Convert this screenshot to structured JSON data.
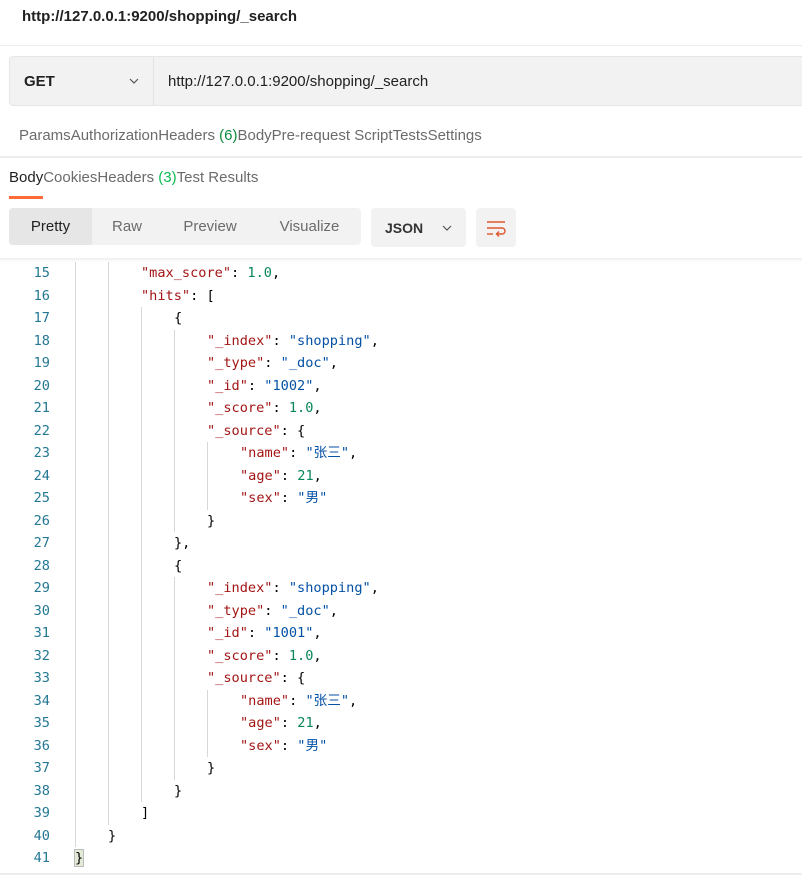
{
  "window": {
    "title": "http://127.0.0.1:9200/shopping/_search"
  },
  "request": {
    "method": "GET",
    "url": "http://127.0.0.1:9200/shopping/_search"
  },
  "request_tabs": [
    {
      "label": "Params"
    },
    {
      "label": "Authorization"
    },
    {
      "label": "Headers",
      "count": "(6)"
    },
    {
      "label": "Body"
    },
    {
      "label": "Pre-request Script"
    },
    {
      "label": "Tests"
    },
    {
      "label": "Settings"
    }
  ],
  "response_tabs": [
    {
      "label": "Body",
      "active": true
    },
    {
      "label": "Cookies"
    },
    {
      "label": "Headers",
      "count": "(3)"
    },
    {
      "label": "Test Results"
    }
  ],
  "view_modes": [
    {
      "label": "Pretty",
      "active": true
    },
    {
      "label": "Raw"
    },
    {
      "label": "Preview"
    },
    {
      "label": "Visualize"
    }
  ],
  "format": {
    "selected": "JSON"
  },
  "colors": {
    "accent": "#ff6c37",
    "key": "#a31515",
    "string": "#0451a5",
    "number": "#098658",
    "line_number": "#237893"
  },
  "icons": {
    "method_dropdown": "chevron-down-icon",
    "format_dropdown": "chevron-down-icon",
    "wrap": "wrap-lines-icon"
  },
  "code_lines": [
    {
      "n": "15",
      "indent": 2,
      "tokens": [
        [
          "k",
          "\"max_score\""
        ],
        [
          "p",
          ": "
        ],
        [
          "n",
          "1.0"
        ],
        [
          "p",
          ","
        ]
      ]
    },
    {
      "n": "16",
      "indent": 2,
      "tokens": [
        [
          "k",
          "\"hits\""
        ],
        [
          "p",
          ": ["
        ]
      ]
    },
    {
      "n": "17",
      "indent": 3,
      "tokens": [
        [
          "p",
          "{"
        ]
      ]
    },
    {
      "n": "18",
      "indent": 4,
      "tokens": [
        [
          "k",
          "\"_index\""
        ],
        [
          "p",
          ": "
        ],
        [
          "s",
          "\"shopping\""
        ],
        [
          "p",
          ","
        ]
      ]
    },
    {
      "n": "19",
      "indent": 4,
      "tokens": [
        [
          "k",
          "\"_type\""
        ],
        [
          "p",
          ": "
        ],
        [
          "s",
          "\"_doc\""
        ],
        [
          "p",
          ","
        ]
      ]
    },
    {
      "n": "20",
      "indent": 4,
      "tokens": [
        [
          "k",
          "\"_id\""
        ],
        [
          "p",
          ": "
        ],
        [
          "s",
          "\"1002\""
        ],
        [
          "p",
          ","
        ]
      ]
    },
    {
      "n": "21",
      "indent": 4,
      "tokens": [
        [
          "k",
          "\"_score\""
        ],
        [
          "p",
          ": "
        ],
        [
          "n",
          "1.0"
        ],
        [
          "p",
          ","
        ]
      ]
    },
    {
      "n": "22",
      "indent": 4,
      "tokens": [
        [
          "k",
          "\"_source\""
        ],
        [
          "p",
          ": {"
        ]
      ]
    },
    {
      "n": "23",
      "indent": 5,
      "tokens": [
        [
          "k",
          "\"name\""
        ],
        [
          "p",
          ": "
        ],
        [
          "s",
          "\"张三\""
        ],
        [
          "p",
          ","
        ]
      ]
    },
    {
      "n": "24",
      "indent": 5,
      "tokens": [
        [
          "k",
          "\"age\""
        ],
        [
          "p",
          ": "
        ],
        [
          "n",
          "21"
        ],
        [
          "p",
          ","
        ]
      ]
    },
    {
      "n": "25",
      "indent": 5,
      "tokens": [
        [
          "k",
          "\"sex\""
        ],
        [
          "p",
          ": "
        ],
        [
          "s",
          "\"男\""
        ]
      ]
    },
    {
      "n": "26",
      "indent": 4,
      "tokens": [
        [
          "p",
          "}"
        ]
      ]
    },
    {
      "n": "27",
      "indent": 3,
      "tokens": [
        [
          "p",
          "},"
        ]
      ]
    },
    {
      "n": "28",
      "indent": 3,
      "tokens": [
        [
          "p",
          "{"
        ]
      ]
    },
    {
      "n": "29",
      "indent": 4,
      "tokens": [
        [
          "k",
          "\"_index\""
        ],
        [
          "p",
          ": "
        ],
        [
          "s",
          "\"shopping\""
        ],
        [
          "p",
          ","
        ]
      ]
    },
    {
      "n": "30",
      "indent": 4,
      "tokens": [
        [
          "k",
          "\"_type\""
        ],
        [
          "p",
          ": "
        ],
        [
          "s",
          "\"_doc\""
        ],
        [
          "p",
          ","
        ]
      ]
    },
    {
      "n": "31",
      "indent": 4,
      "tokens": [
        [
          "k",
          "\"_id\""
        ],
        [
          "p",
          ": "
        ],
        [
          "s",
          "\"1001\""
        ],
        [
          "p",
          ","
        ]
      ]
    },
    {
      "n": "32",
      "indent": 4,
      "tokens": [
        [
          "k",
          "\"_score\""
        ],
        [
          "p",
          ": "
        ],
        [
          "n",
          "1.0"
        ],
        [
          "p",
          ","
        ]
      ]
    },
    {
      "n": "33",
      "indent": 4,
      "tokens": [
        [
          "k",
          "\"_source\""
        ],
        [
          "p",
          ": {"
        ]
      ]
    },
    {
      "n": "34",
      "indent": 5,
      "tokens": [
        [
          "k",
          "\"name\""
        ],
        [
          "p",
          ": "
        ],
        [
          "s",
          "\"张三\""
        ],
        [
          "p",
          ","
        ]
      ]
    },
    {
      "n": "35",
      "indent": 5,
      "tokens": [
        [
          "k",
          "\"age\""
        ],
        [
          "p",
          ": "
        ],
        [
          "n",
          "21"
        ],
        [
          "p",
          ","
        ]
      ]
    },
    {
      "n": "36",
      "indent": 5,
      "tokens": [
        [
          "k",
          "\"sex\""
        ],
        [
          "p",
          ": "
        ],
        [
          "s",
          "\"男\""
        ]
      ]
    },
    {
      "n": "37",
      "indent": 4,
      "tokens": [
        [
          "p",
          "}"
        ]
      ]
    },
    {
      "n": "38",
      "indent": 3,
      "tokens": [
        [
          "p",
          "}"
        ]
      ]
    },
    {
      "n": "39",
      "indent": 2,
      "tokens": [
        [
          "p",
          "]"
        ]
      ]
    },
    {
      "n": "40",
      "indent": 1,
      "tokens": [
        [
          "p",
          "}"
        ]
      ]
    },
    {
      "n": "41",
      "indent": 0,
      "tokens": [
        [
          "p",
          "}"
        ]
      ],
      "cursor": true
    }
  ]
}
